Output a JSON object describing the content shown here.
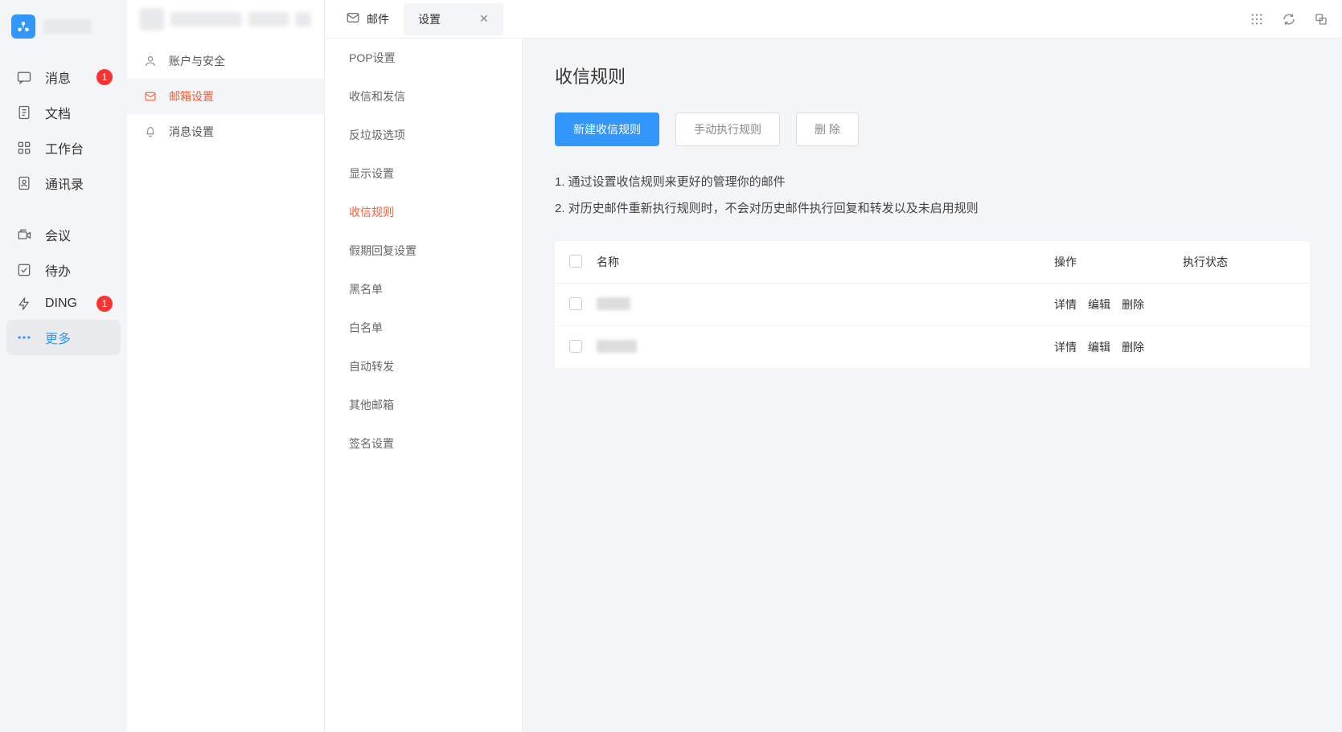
{
  "nav": {
    "items": [
      {
        "label": "消息",
        "icon": "chat",
        "badge": "1"
      },
      {
        "label": "文档",
        "icon": "doc"
      },
      {
        "label": "工作台",
        "icon": "grid"
      },
      {
        "label": "通讯录",
        "icon": "contacts"
      }
    ],
    "items2": [
      {
        "label": "会议",
        "icon": "video"
      },
      {
        "label": "待办",
        "icon": "todo"
      },
      {
        "label": "DING",
        "icon": "bolt",
        "badge": "1"
      },
      {
        "label": "更多",
        "icon": "more",
        "active": true
      }
    ]
  },
  "settings_nav": {
    "items": [
      {
        "label": "账户与安全",
        "icon": "user"
      },
      {
        "label": "邮箱设置",
        "icon": "mail",
        "active": true
      },
      {
        "label": "消息设置",
        "icon": "bell"
      }
    ]
  },
  "mail_settings": {
    "items": [
      {
        "label": "POP设置"
      },
      {
        "label": "收信和发信"
      },
      {
        "label": "反垃圾选项"
      },
      {
        "label": "显示设置"
      },
      {
        "label": "收信规则",
        "active": true
      },
      {
        "label": "假期回复设置"
      },
      {
        "label": "黑名单"
      },
      {
        "label": "白名单"
      },
      {
        "label": "自动转发"
      },
      {
        "label": "其他邮箱"
      },
      {
        "label": "签名设置"
      }
    ]
  },
  "tabs": {
    "items": [
      {
        "label": "邮件",
        "icon": "envelope"
      },
      {
        "label": "设置",
        "active": true,
        "closable": true
      }
    ]
  },
  "page": {
    "title": "收信规则",
    "buttons": {
      "primary": "新建收信规则",
      "manual": "手动执行规则",
      "delete": "删 除"
    },
    "desc": [
      "1. 通过设置收信规则来更好的管理你的邮件",
      "2. 对历史邮件重新执行规则时，不会对历史邮件执行回复和转发以及未启用规则"
    ],
    "table": {
      "headers": {
        "name": "名称",
        "ops": "操作",
        "status": "执行状态"
      },
      "ops": {
        "detail": "详情",
        "edit": "编辑",
        "del": "删除"
      },
      "rows": [
        {
          "name": ""
        },
        {
          "name": ""
        }
      ]
    }
  }
}
